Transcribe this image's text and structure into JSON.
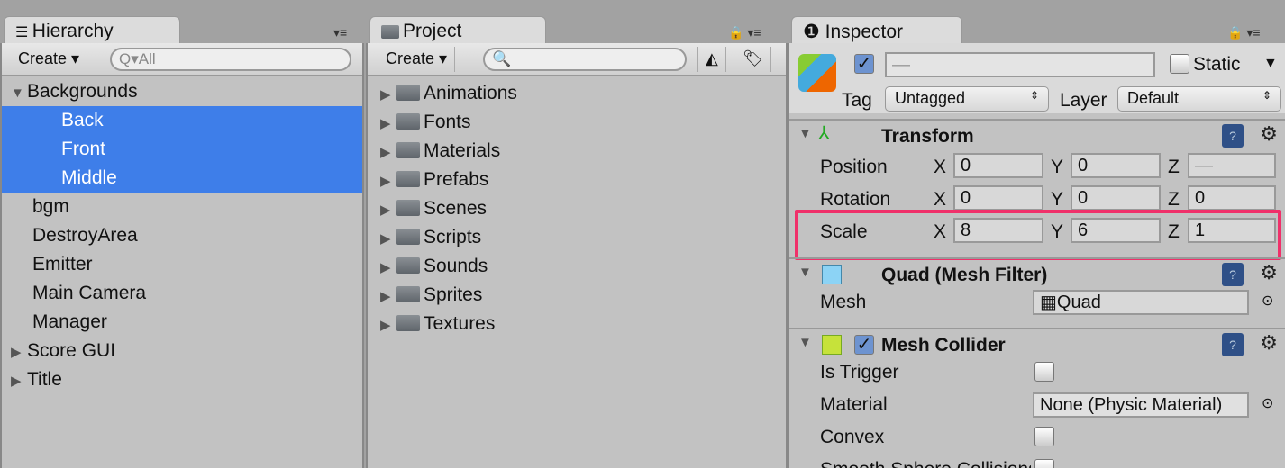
{
  "hierarchy": {
    "tab": "Hierarchy",
    "create": "Create",
    "search_placeholder": "All",
    "items": [
      {
        "label": "Backgrounds",
        "expanded": true
      },
      {
        "label": "Back",
        "selected": true
      },
      {
        "label": "Front",
        "selected": true
      },
      {
        "label": "Middle",
        "selected": true
      },
      {
        "label": "bgm"
      },
      {
        "label": "DestroyArea"
      },
      {
        "label": "Emitter"
      },
      {
        "label": "Main Camera"
      },
      {
        "label": "Manager"
      },
      {
        "label": "Score GUI",
        "collapsed": true
      },
      {
        "label": "Title",
        "collapsed": true
      }
    ]
  },
  "project": {
    "tab": "Project",
    "create": "Create",
    "search_placeholder": "",
    "folders": [
      "Animations",
      "Fonts",
      "Materials",
      "Prefabs",
      "Scenes",
      "Scripts",
      "Sounds",
      "Sprites",
      "Textures"
    ]
  },
  "inspector": {
    "tab": "Inspector",
    "name_value": "—",
    "active": true,
    "static_label": "Static",
    "static_checked": false,
    "tag_label": "Tag",
    "tag_value": "Untagged",
    "layer_label": "Layer",
    "layer_value": "Default",
    "transform": {
      "title": "Transform",
      "position": {
        "label": "Position",
        "x": "0",
        "y": "0",
        "z": "—"
      },
      "rotation": {
        "label": "Rotation",
        "x": "0",
        "y": "0",
        "z": "0"
      },
      "scale": {
        "label": "Scale",
        "x": "8",
        "y": "6",
        "z": "1"
      },
      "axes": {
        "x": "X",
        "y": "Y",
        "z": "Z"
      }
    },
    "mesh_filter": {
      "title": "Quad (Mesh Filter)",
      "mesh_label": "Mesh",
      "mesh_value": "Quad"
    },
    "mesh_collider": {
      "title": "Mesh Collider",
      "enabled": true,
      "is_trigger": "Is Trigger",
      "material": "Material",
      "material_value": "None (Physic Material)",
      "convex": "Convex",
      "smooth": "Smooth Sphere Collisions"
    },
    "highlight_color": "#f0306a"
  }
}
